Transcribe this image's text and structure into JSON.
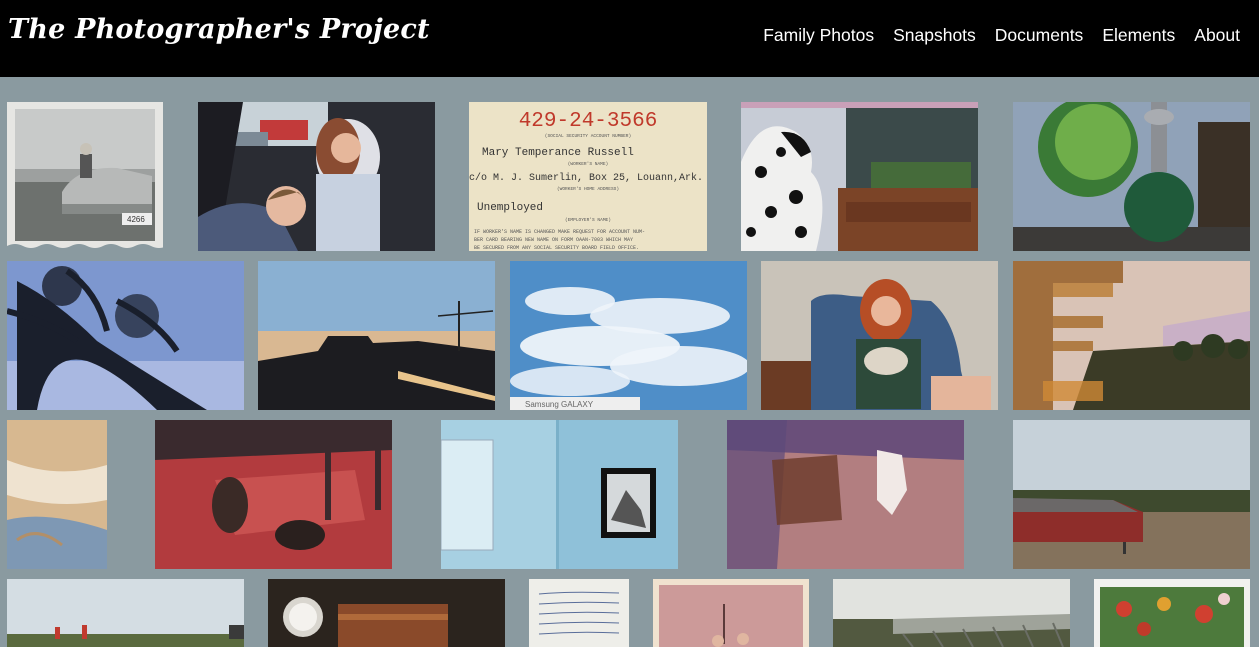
{
  "site": {
    "title": "The Photographer's Project"
  },
  "nav": {
    "items": [
      {
        "label": "Family Photos"
      },
      {
        "label": "Snapshots"
      },
      {
        "label": "Documents"
      },
      {
        "label": "Elements"
      },
      {
        "label": "About"
      }
    ]
  },
  "document": {
    "number": "429-24-3566",
    "number_caption": "(SOCIAL SECURITY ACCOUNT NUMBER)",
    "name": "Mary Temperance Russell",
    "name_caption": "(WORKER'S NAME)",
    "address": "c/o M. J. Sumerlin, Box 25, Louann,Ark.",
    "address_caption": "(WORKER'S HOME ADDRESS)",
    "employer": "Unemployed",
    "employer_caption": "(EMPLOYER'S NAME)",
    "notice_line1": "IF WORKER'S NAME IS CHANGED MAKE REQUEST FOR ACCOUNT NUM-",
    "notice_line2": "BER CARD BEARING NEW NAME ON FORM OAAN-7003 WHICH MAY",
    "notice_line3": "BE SECURED FROM ANY SOCIAL SECURITY BOARD FIELD OFFICE."
  },
  "photo_texts": {
    "license_plate": "4266",
    "camera_label": "Samsung GALAXY"
  },
  "colors": {
    "page_background": "#8a9aa0",
    "header_background": "#000000",
    "nav_text": "#ffffff",
    "ssn_red": "#c0392b"
  }
}
